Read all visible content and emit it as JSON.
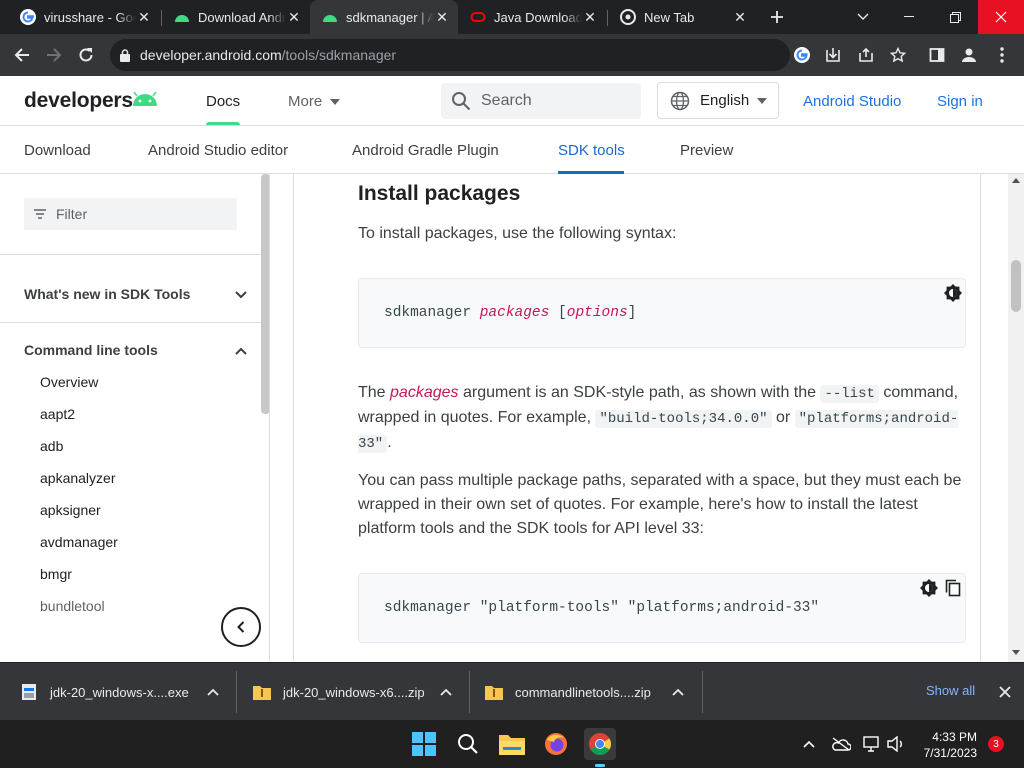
{
  "browser": {
    "tabs": [
      {
        "label": "virusshare - Goo",
        "icon": "google-icon",
        "active": false
      },
      {
        "label": "Download Andr",
        "icon": "android-icon",
        "active": false
      },
      {
        "label": "sdkmanager | A",
        "icon": "android-icon",
        "active": true
      },
      {
        "label": "Java Downloads",
        "icon": "oracle-icon",
        "active": false
      },
      {
        "label": "New Tab",
        "icon": "chrome-icon",
        "active": false
      }
    ],
    "url_host": "developer.android.com",
    "url_path": "/tools/sdkmanager"
  },
  "site": {
    "logo_text": "developers",
    "nav_docs": "Docs",
    "nav_more": "More",
    "search_placeholder": "Search",
    "language": "English",
    "android_studio": "Android Studio",
    "sign_in": "Sign in",
    "subtabs": [
      "Download",
      "Android Studio editor",
      "Android Gradle Plugin",
      "SDK tools",
      "Preview"
    ]
  },
  "sidebar": {
    "filter_placeholder": "Filter",
    "section_whats_new": "What's new in SDK Tools",
    "section_command_line": "Command line tools",
    "items": [
      "Overview",
      "aapt2",
      "adb",
      "apkanalyzer",
      "apksigner",
      "avdmanager",
      "bmgr",
      "bundletool"
    ]
  },
  "content": {
    "heading": "Install packages",
    "intro": "To install packages, use the following syntax:",
    "code1_cmd": "sdkmanager ",
    "code1_var": "packages",
    "code1_open": " [",
    "code1_opt": "options",
    "code1_close": "]",
    "p2_the": "The ",
    "p2_packages": "packages",
    "p2_rest": " argument is an SDK-style path, as shown with the ",
    "p2_list": "--list",
    "p2_cmd": " command, wrapped in quotes. For example, ",
    "p2_ex1": "\"build-tools;34.0.0\"",
    "p2_or": " or ",
    "p2_ex2": "\"platforms;android-33\"",
    "p2_end": ".",
    "p3": "You can pass multiple package paths, separated with a space, but they must each be wrapped in their own set of quotes. For example, here's how to install the latest platform tools and the SDK tools for API level 33:",
    "code2": "sdkmanager \"platform-tools\" \"platforms;android-33\""
  },
  "downloads": {
    "items": [
      {
        "name": "jdk-20_windows-x....exe",
        "icon": "installer-icon"
      },
      {
        "name": "jdk-20_windows-x6....zip",
        "icon": "zip-folder-icon"
      },
      {
        "name": "commandlinetools....zip",
        "icon": "zip-folder-icon"
      }
    ],
    "show_all": "Show all"
  },
  "taskbar": {
    "time": "4:33 PM",
    "date": "7/31/2023",
    "notifications": "3"
  },
  "colors": {
    "android_green": "#3ddc84",
    "link_blue": "#1a73e8",
    "code_var": "#c2185b"
  }
}
